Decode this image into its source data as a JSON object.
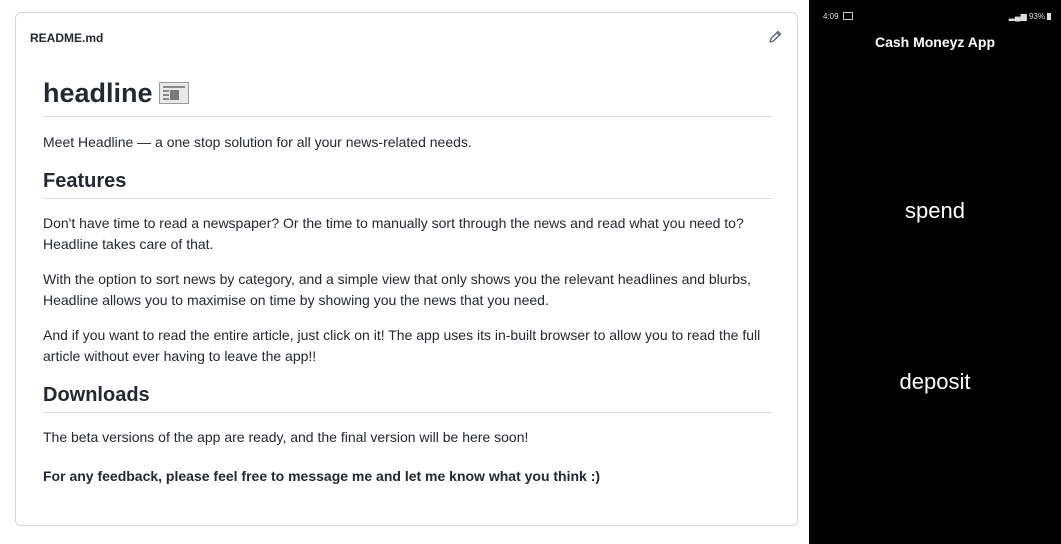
{
  "readme": {
    "filename": "README.md",
    "title": "headline",
    "intro": "Meet Headline — a one stop solution for all your news-related needs.",
    "features_heading": "Features",
    "features_p1": "Don't have time to read a newspaper? Or the time to manually sort through the news and read what you need to? Headline takes care of that.",
    "features_p2": "With the option to sort news by category, and a simple view that only shows you the relevant headlines and blurbs, Headline allows you to maximise on time by showing you the news that you need.",
    "features_p3": "And if you want to read the entire article, just click on it! The app uses its in-built browser to allow you to read the full article without ever having to leave the app!!",
    "downloads_heading": "Downloads",
    "downloads_p1": "The beta versions of the app are ready, and the final version will be here soon!",
    "feedback": "For any feedback, please feel free to message me and let me know what you think :)"
  },
  "phone": {
    "time": "4:09",
    "battery": "93%",
    "app_title": "Cash Moneyz App",
    "spend_label": "spend",
    "deposit_label": "deposit"
  }
}
